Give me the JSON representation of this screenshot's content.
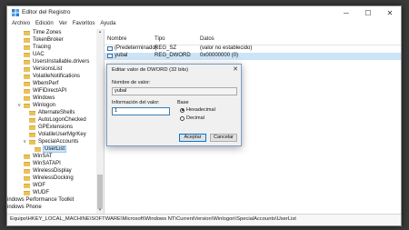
{
  "window": {
    "title": "Editor del Registro",
    "controls": {
      "minimize": "─",
      "maximize": "☐",
      "close": "✕"
    }
  },
  "menu": [
    "Archivo",
    "Edición",
    "Ver",
    "Favoritos",
    "Ayuda"
  ],
  "tree": {
    "items": [
      {
        "label": "Time Zones"
      },
      {
        "label": "TokenBroker"
      },
      {
        "label": "Tracing"
      },
      {
        "label": "UAC"
      },
      {
        "label": "UsersInstallable.drivers"
      },
      {
        "label": "VersionsList"
      },
      {
        "label": "VolatileNotifications"
      },
      {
        "label": "WbemPerf"
      },
      {
        "label": "WiFiDirectAPI"
      },
      {
        "label": "Windows"
      },
      {
        "label": "Winlogon",
        "expander": "v"
      },
      {
        "label": "AlternateShells",
        "indent": 1
      },
      {
        "label": "AutoLogonChecked",
        "indent": 1
      },
      {
        "label": "GPExtensions",
        "indent": 1
      },
      {
        "label": "VolatileUserMgrKey",
        "indent": 1
      },
      {
        "label": "SpecialAccounts",
        "indent": 1,
        "expander": "v"
      },
      {
        "label": "UserList",
        "indent": 2,
        "selected": true
      },
      {
        "label": "WinSAT"
      },
      {
        "label": "WinSATAPI"
      },
      {
        "label": "WirelessDisplay"
      },
      {
        "label": "WirelessDocking"
      },
      {
        "label": "WOF"
      },
      {
        "label": "WUDF"
      },
      {
        "label": "indows Performance Toolkit",
        "root": true
      },
      {
        "label": "indows Phone",
        "root": true
      }
    ]
  },
  "list": {
    "columns": [
      "Nombre",
      "Tipo",
      "Datos"
    ],
    "rows": [
      {
        "name": "(Predeterminado)",
        "type": "REG_SZ",
        "data": "(valor no establecido)"
      },
      {
        "name": "yubal",
        "type": "REG_DWORD",
        "data": "0x00000000 (0)",
        "selected": true
      }
    ]
  },
  "dialog": {
    "title": "Editar valor de DWORD (32 bits)",
    "close": "✕",
    "name_label": "Nombre de valor:",
    "name_value": "yubal",
    "data_label": "Información del valor:",
    "data_value": "1",
    "base_label": "Base",
    "radios": [
      {
        "label": "Hexadecimal",
        "checked": true
      },
      {
        "label": "Decimal",
        "checked": false
      }
    ],
    "ok": "Aceptar",
    "cancel": "Cancelar"
  },
  "status": {
    "path": "Equipo\\HKEY_LOCAL_MACHINE\\SOFTWARE\\Microsoft\\Windows NT\\CurrentVersion\\Winlogon\\SpecialAccounts\\UserList"
  },
  "colors": {
    "selection": "#cce4f7",
    "folder": "#e9c25a",
    "accent": "#0078d7"
  }
}
